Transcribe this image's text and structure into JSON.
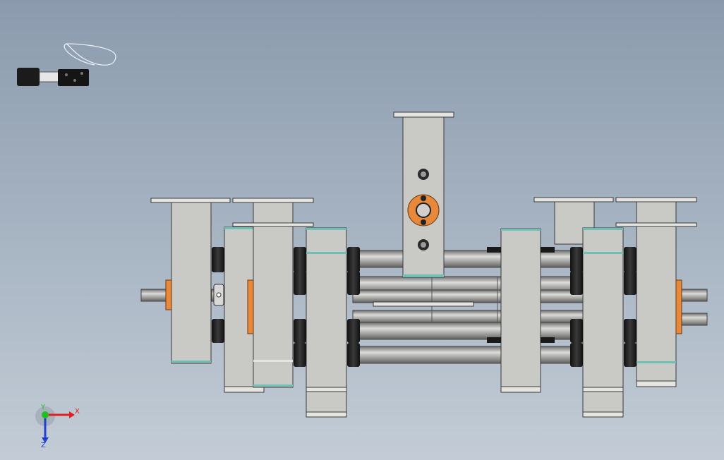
{
  "viewport": {
    "background_top": "#8b9bad",
    "background_bottom": "#c3ccd6"
  },
  "colors": {
    "plate": "#c9c9c5",
    "plate_edge": "#3a3a3a",
    "rod": "#9a9a98",
    "rod_highlight": "#d8d8d6",
    "bushing": "#242424",
    "orange": "#e8883a",
    "teal": "#6fbfb5"
  },
  "triad": {
    "x_label": "X",
    "y_label": "Y",
    "z_label": "Z",
    "x_color": "#e02020",
    "y_color": "#20c020",
    "z_color": "#2040d0"
  },
  "icons": {
    "cursor": "rotate-cursor-icon",
    "triad": "axis-triad-icon"
  }
}
